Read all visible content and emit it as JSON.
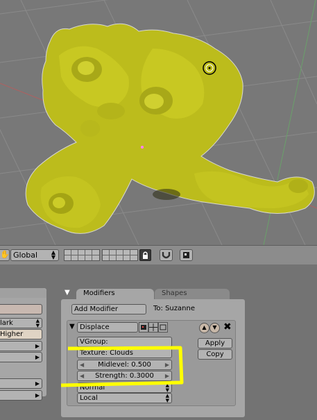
{
  "viewport3d": {
    "object_color": "#c8c81e",
    "grid_color": "#8a8a8a"
  },
  "header": {
    "transform_orientation": "Global",
    "lock_icon": "lock-icon",
    "snap_icon": "magnet-icon",
    "render_icon": "render-icon"
  },
  "left_panel": {
    "row1_value": "lark",
    "row2_value": "Higher"
  },
  "modifiers_panel": {
    "tabs": [
      "Modifiers",
      "Shapes"
    ],
    "add_modifier_label": "Add Modifier",
    "to_label": "To: Suzanne",
    "modifier": {
      "name": "Displace",
      "vgroup_label": "VGroup:",
      "texture_label": "Texture: Clouds",
      "midlevel_label": "Midlevel: 0.500",
      "strength_label": "Strength: 0.3000",
      "direction_value": "Normal",
      "coords_value": "Local",
      "apply_label": "Apply",
      "copy_label": "Copy"
    }
  },
  "highlight_color": "#ffff00"
}
